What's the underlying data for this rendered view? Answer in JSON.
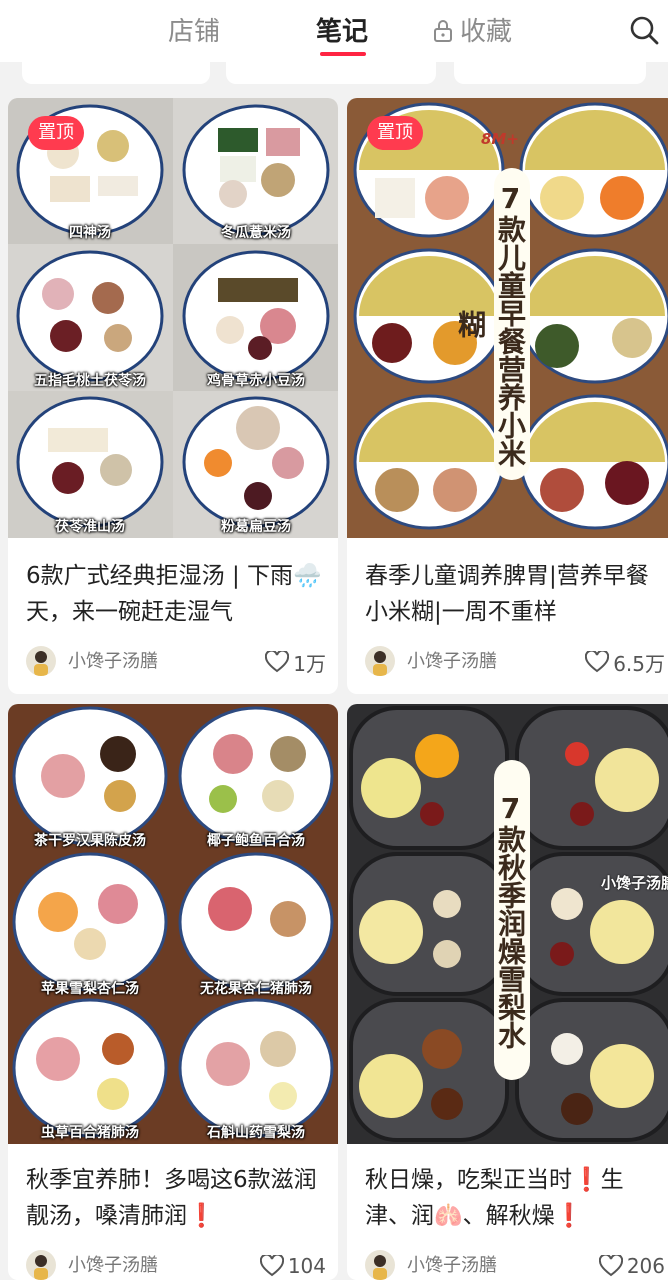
{
  "tabs": [
    {
      "label": "店铺",
      "active": false
    },
    {
      "label": "笔记",
      "active": true
    },
    {
      "label": "收藏",
      "active": false,
      "icon": "lock-icon"
    }
  ],
  "colors": {
    "accent": "#ff2442",
    "badge": "#ff3b4f"
  },
  "cards": [
    {
      "badge": "置顶",
      "title": "6款广式经典拒湿汤 | 下雨🌧️天，来一碗赶走湿气",
      "author": "小馋子汤膳",
      "likes": "1万",
      "labels": [
        "四神汤",
        "冬瓜薏米汤",
        "五指毛桃土茯苓汤",
        "鸡骨草赤小豆汤",
        "茯苓淮山汤",
        "粉葛扁豆汤"
      ]
    },
    {
      "badge": "置顶",
      "corner_text": "8M+",
      "overlay_text": "7款儿童早餐营养小米糊",
      "title": "春季儿童调养脾胃|营养早餐小米糊|一周不重样",
      "author": "小馋子汤膳",
      "likes": "6.5万"
    },
    {
      "title": "秋季宜养肺！多喝这6款滋润靓汤，嗓清肺润❗",
      "author": "小馋子汤膳",
      "likes": "104",
      "labels": [
        "茶干罗汉果陈皮汤",
        "椰子鲍鱼百合汤",
        "苹果雪梨杏仁汤",
        "无花果杏仁猪肺汤",
        "虫草百合猪肺汤",
        "石斛山药雪梨汤"
      ]
    },
    {
      "overlay_text": "7款秋季润燥雪梨水",
      "watermark": "小馋子汤膳",
      "title": "秋日燥，吃梨正当时❗生津、润🫁、解秋燥❗",
      "author": "小馋子汤膳",
      "likes": "206"
    }
  ]
}
